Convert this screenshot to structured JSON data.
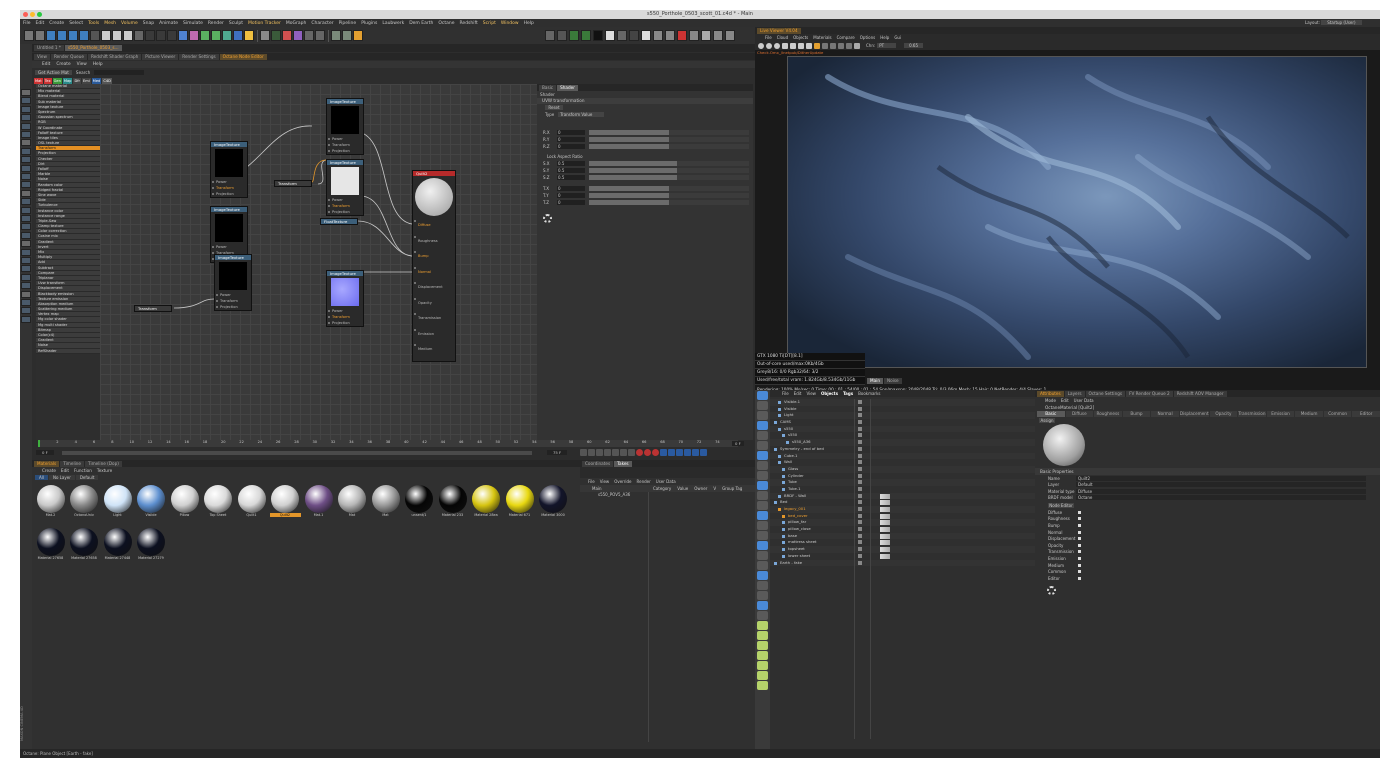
{
  "window_title": "s550_Porthole_0503_scott_01.c4d * - Main",
  "menubar": [
    "File",
    "Edit",
    "Create",
    "Select",
    "Tools",
    "Mesh",
    "Volume",
    "Snap",
    "Animate",
    "Simulate",
    "Render",
    "Sculpt",
    "Motion Tracker",
    "MoGraph",
    "Character",
    "Pipeline",
    "Plugins",
    "Laubwerk",
    "Dem Earth",
    "Octane",
    "Redshift",
    "Script",
    "Window",
    "Help"
  ],
  "layout": {
    "label": "Layout:",
    "value": "Startup (User)"
  },
  "doc_tabs": [
    "Untitled 1 *",
    "s550_Porthole_0503_s..."
  ],
  "ne_tabs": [
    "View",
    "Render Queue",
    "Redshift Shader Graph",
    "Picture Viewer",
    "Render Settings",
    "Octane Node Editor"
  ],
  "ne_menu": [
    "Edit",
    "Create",
    "View",
    "Help"
  ],
  "ne_bar": [
    "Get Active Mat",
    "Search"
  ],
  "ne_filters": [
    "Mat",
    "Tex",
    "Gen",
    "Map",
    "Dfr",
    "Emi",
    "Med",
    "C4D"
  ],
  "node_list": [
    "Octane material",
    "Mix material",
    "Blend material",
    "Sub material",
    "Image texture",
    "Spectrum",
    "Gaussian spectrum",
    "RGB",
    "W Coordinate",
    "Falloff texture",
    "Image tiles",
    "OSL texture",
    "Transform",
    "Projection",
    "Checker",
    "Dirt",
    "Falloff",
    "Marble",
    "Noise",
    "Random color",
    "Ridged fractal",
    "Sine wave",
    "Side",
    "Turbulence",
    "Instance color",
    "Instance range",
    "Triple-Saw",
    "Clamp texture",
    "Color correction",
    "Cosine mix",
    "Gradient",
    "Invert",
    "Mix",
    "Multiply",
    "Add",
    "Subtract",
    "Compare",
    "Triplanar",
    "Uvw transform",
    "Displacement",
    "Blackbody emission",
    "Texture emission",
    "Absorption medium",
    "Scattering medium",
    "Vertex map",
    "Mg color shader",
    "Mg multi shader",
    "Bitmap",
    "Color(c4)",
    "Gradient",
    "Noise",
    "RefShader"
  ],
  "node_list_highlight": 12,
  "nodes": {
    "img1": {
      "title": "ImageTexture",
      "ports": [
        "Power",
        "Transform",
        "Projection"
      ]
    },
    "img2": {
      "title": "ImageTexture",
      "ports": [
        "Power",
        "Transform",
        "Projection"
      ]
    },
    "img3": {
      "title": "ImageTexture",
      "ports": [
        "Power",
        "Transform",
        "Projection"
      ]
    },
    "img4": {
      "title": "ImageTexture",
      "ports": [
        "Power",
        "Transform",
        "Projection"
      ]
    },
    "img5": {
      "title": "ImageTexture",
      "ports": [
        "Power",
        "Transform",
        "Projection"
      ]
    },
    "img6": {
      "title": "ImageTexture",
      "ports": [
        "Power",
        "Transform",
        "Projection"
      ]
    },
    "transform1": {
      "title": "Transform"
    },
    "transform2": {
      "title": "Transform"
    },
    "float": {
      "title": "FloatTexture"
    },
    "quilt": {
      "title": "Quilt2",
      "ports": [
        "Diffuse",
        "Roughness",
        "Bump",
        "Normal",
        "Displacement",
        "Opacity",
        "Transmission",
        "Emission",
        "Medium"
      ]
    }
  },
  "attr_panel": {
    "tabs": [
      "Basic",
      "Shader"
    ],
    "section": "Shader",
    "group": "UVW transformation",
    "reset": "Reset",
    "type_label": "Type",
    "type_value": "Transform Value",
    "rows": [
      {
        "label": "R.X",
        "value": "0"
      },
      {
        "label": "R.Y",
        "value": "0"
      },
      {
        "label": "R.Z",
        "value": "0"
      }
    ],
    "lock": "Lock Aspect Ratio",
    "srows": [
      {
        "label": "S.X",
        "value": "0.5"
      },
      {
        "label": "S.Y",
        "value": "0.5"
      },
      {
        "label": "S.Z",
        "value": "0.5"
      }
    ],
    "trows": [
      {
        "label": "T.X",
        "value": "0"
      },
      {
        "label": "T.Y",
        "value": "0"
      },
      {
        "label": "T.Z",
        "value": "0"
      }
    ]
  },
  "timeline": {
    "ticks": [
      "0",
      "2",
      "4",
      "6",
      "8",
      "10",
      "12",
      "14",
      "16",
      "18",
      "20",
      "22",
      "24",
      "26",
      "28",
      "30",
      "32",
      "34",
      "36",
      "38",
      "40",
      "42",
      "44",
      "46",
      "48",
      "50",
      "52",
      "54",
      "56",
      "58",
      "60",
      "62",
      "64",
      "66",
      "68",
      "70",
      "72",
      "74"
    ],
    "start": "0 F",
    "end": "75 F",
    "current": "0 F"
  },
  "mat_tabs": [
    "Materials",
    "Timeline",
    "Timeline (Dop)"
  ],
  "mat_menu": [
    "Create",
    "Edit",
    "Function",
    "Texture"
  ],
  "mat_filters": [
    "All",
    "No Layer",
    "Default"
  ],
  "materials": [
    {
      "name": "Mat.2",
      "c": "#c9c9c9"
    },
    {
      "name": "OctanoUniv",
      "c": "#888"
    },
    {
      "name": "Light",
      "c": "#cfe3f7"
    },
    {
      "name": "Visible",
      "c": "#5d8fcf"
    },
    {
      "name": "Pillow",
      "c": "#d0d0d0"
    },
    {
      "name": "Top Sheet",
      "c": "#dadada"
    },
    {
      "name": "Quilt1",
      "c": "#d8d8d8"
    },
    {
      "name": "Quilt2",
      "c": "#d0d0d0"
    },
    {
      "name": "Mat.1",
      "c": "#6e4e86"
    },
    {
      "name": "Mat",
      "c": "#b6b6b6"
    },
    {
      "name": "Mat",
      "c": "#9a9a9a"
    },
    {
      "name": "unsent/1",
      "c": "#050505"
    },
    {
      "name": "Material 233",
      "c": "#050505"
    },
    {
      "name": "Material 28ea",
      "c": "#d6c410"
    },
    {
      "name": "Material 671",
      "c": "#e8d810"
    },
    {
      "name": "Material 3000",
      "c": "#12142a"
    },
    {
      "name": "Material 27658",
      "c": "#0c1020"
    },
    {
      "name": "Material 27658",
      "c": "#0c1020"
    },
    {
      "name": "Material 27448",
      "c": "#0c1020"
    },
    {
      "name": "Material 27279",
      "c": "#0c1020"
    }
  ],
  "mat_selected": 7,
  "coord": {
    "tabs": [
      "Coordinates",
      "Takes"
    ],
    "menu": [
      "File",
      "View",
      "Override",
      "Render",
      "User Data"
    ],
    "cols": [
      "Main",
      "Category",
      "Value",
      "Owner",
      "V",
      "Group Tag"
    ],
    "take": "s550_POV5_A36"
  },
  "live_viewer": {
    "tab": "Live Viewer V4.04",
    "menu": [
      "File",
      "Cloud",
      "Objects",
      "Materials",
      "Compare",
      "Options",
      "Help",
      "Gui"
    ],
    "chn_label": "Chn:",
    "chn_value": "PT",
    "zoom": "0.65",
    "path": "Check.Omx_/Inetpub/DitherUpdate",
    "stats": [
      "GTX 1080 Ti[DT][8.1]",
      "Out-of-core used/max:0Kb/4Gb",
      "Grey8/16: 0/0        Rgb32/64: 3/2",
      "Used/free/total vram: 1.824Gb/8.534Gb/11Gb"
    ],
    "tabs": [
      "Main",
      "Noise"
    ],
    "render_bar": "Rendering: 100%  Ms/sec: 0   Time: 00 : 01 : 54/00 : 01 : 54  Spp/maxspp: 2048/2048   Tri: 0/3.06m   Mesh: 15   Hair: 0   NetRender: 4/4   Slaves: 1"
  },
  "obj_menu": [
    "File",
    "Edit",
    "View",
    "Objects",
    "Tags",
    "Bookmarks"
  ],
  "objects": [
    {
      "d": 1,
      "n": "Visible.1"
    },
    {
      "d": 1,
      "n": "Visible"
    },
    {
      "d": 1,
      "n": "Light"
    },
    {
      "d": 0,
      "n": "CAMS"
    },
    {
      "d": 1,
      "n": "s550"
    },
    {
      "d": 2,
      "n": "s550"
    },
    {
      "d": 3,
      "n": "s550_A36"
    },
    {
      "d": 0,
      "n": "Symmetry - end of bed"
    },
    {
      "d": 1,
      "n": "Cube.1"
    },
    {
      "d": 1,
      "n": "Wall"
    },
    {
      "d": 2,
      "n": "Glass"
    },
    {
      "d": 2,
      "n": "Cylinder"
    },
    {
      "d": 2,
      "n": "Tube"
    },
    {
      "d": 2,
      "n": "Tube.1"
    },
    {
      "d": 1,
      "n": "BRDF - Wall"
    },
    {
      "d": 0,
      "n": "Bed"
    },
    {
      "d": 1,
      "n": "legacy_001",
      "o": 1
    },
    {
      "d": 2,
      "n": "bed_cover",
      "o": 1
    },
    {
      "d": 2,
      "n": "pillow_far"
    },
    {
      "d": 2,
      "n": "pillow_close"
    },
    {
      "d": 2,
      "n": "base"
    },
    {
      "d": 2,
      "n": "mattress sheet"
    },
    {
      "d": 2,
      "n": "topsheet"
    },
    {
      "d": 2,
      "n": "lower sheet"
    },
    {
      "d": 0,
      "n": "Earth - fake"
    }
  ],
  "attr_tabs": [
    "Attributes",
    "Layers",
    "Octane Settings",
    "FV Render Queue 2",
    "Redshift AOV Manager"
  ],
  "attr_menu": [
    "Mode",
    "Edit",
    "User Data"
  ],
  "attr_title": "OctaneMaterial [Quilt2]",
  "attr_subtabs": [
    "Basic",
    "Diffuse",
    "Roughness",
    "Bump",
    "Normal",
    "Displacement",
    "Opacity",
    "Transmission",
    "Emission",
    "Medium",
    "Common",
    "Editor"
  ],
  "assign": "Assign",
  "basic_props": "Basic Properties",
  "props": [
    {
      "l": "Name",
      "v": "Quilt2"
    },
    {
      "l": "Layer",
      "v": "Default"
    },
    {
      "l": "Material type",
      "v": "Diffuse"
    },
    {
      "l": "BRDF model",
      "v": "Octane"
    }
  ],
  "node_editor_btn": "Node Editor",
  "channels": [
    "Diffuse",
    "Roughness",
    "Bump",
    "Normal",
    "Displacement",
    "Opacity",
    "Transmission",
    "Emission",
    "Medium",
    "Common",
    "Editor"
  ],
  "status": "Octane:       Plane Object [Earth - fake]",
  "logo": "MAXON CINEMA 4D"
}
